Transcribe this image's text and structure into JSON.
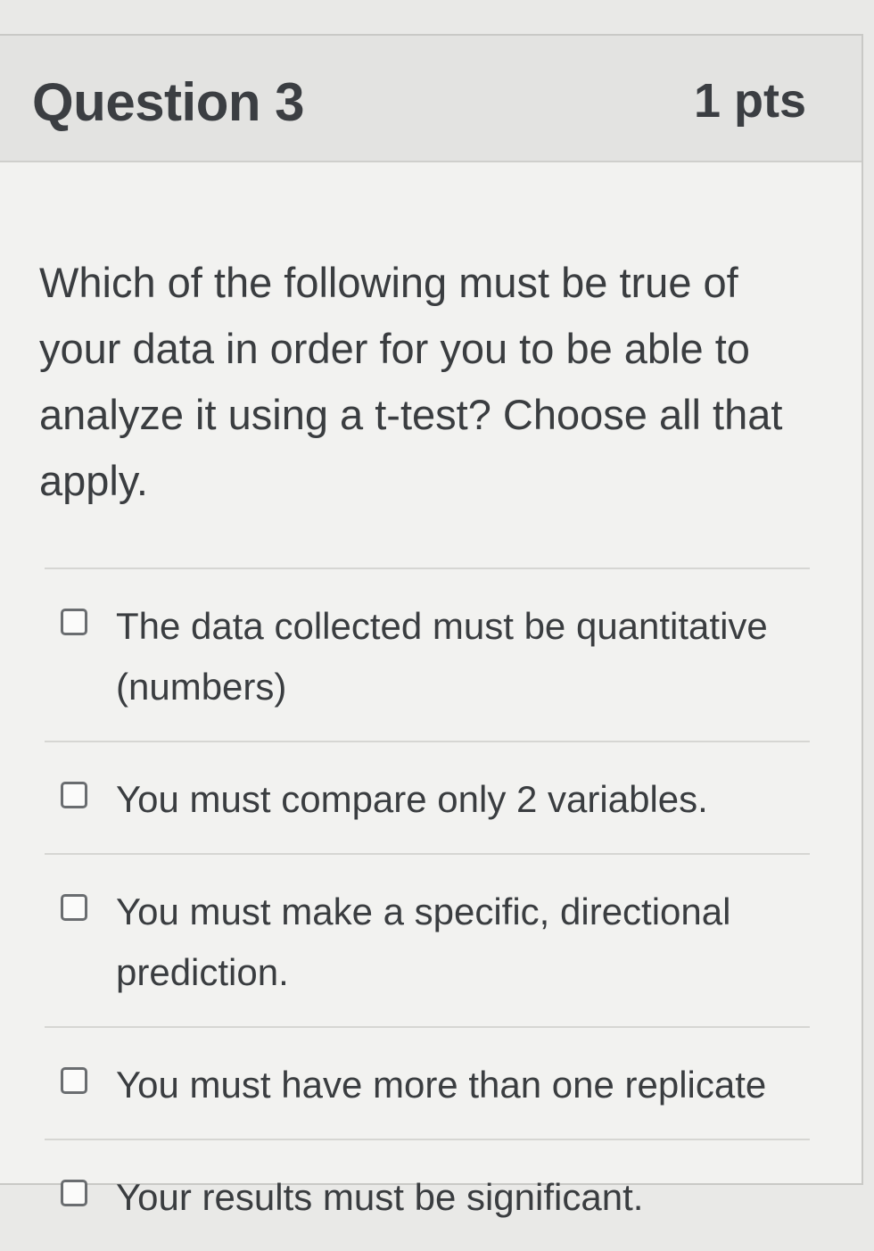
{
  "question": {
    "title": "Question 3",
    "points": "1 pts",
    "prompt": "Which of the following must be true of your data in order for you to be able to analyze it using a t-test? Choose all that apply."
  },
  "answers": [
    {
      "label": "The data collected must be quantitative (numbers)",
      "checked": false
    },
    {
      "label": "You must compare only 2 variables.",
      "checked": false
    },
    {
      "label": "You must make a specific, directional prediction.",
      "checked": false
    },
    {
      "label": "You must have more than one replicate",
      "checked": false
    },
    {
      "label": "Your results must be significant.",
      "checked": false
    }
  ]
}
